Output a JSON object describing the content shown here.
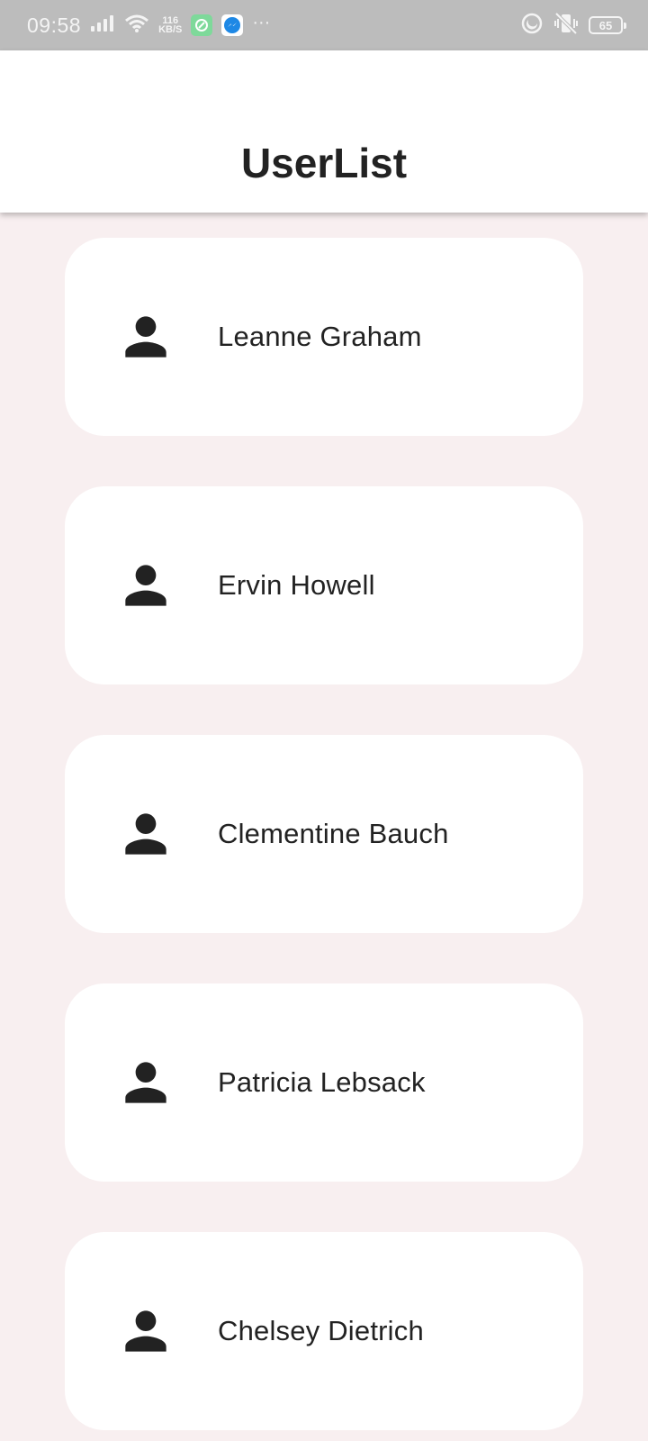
{
  "status_bar": {
    "time": "09:58",
    "speed_value": "116",
    "speed_unit": "KB/S",
    "battery": "65",
    "overflow": "···",
    "icons": [
      "signal-icon",
      "wifi-icon",
      "app-notification-icon",
      "messenger-icon",
      "do-not-disturb-icon",
      "vibrate-off-icon",
      "battery-icon"
    ]
  },
  "app_bar": {
    "title": "UserList"
  },
  "users": [
    {
      "name": "Leanne Graham"
    },
    {
      "name": "Ervin Howell"
    },
    {
      "name": "Clementine Bauch"
    },
    {
      "name": "Patricia Lebsack"
    },
    {
      "name": "Chelsey Dietrich"
    }
  ],
  "colors": {
    "status_bar": "#bcbcbc",
    "app_bar": "#ffffff",
    "background": "#f8eff0",
    "card": "#ffffff",
    "text": "#222222"
  }
}
